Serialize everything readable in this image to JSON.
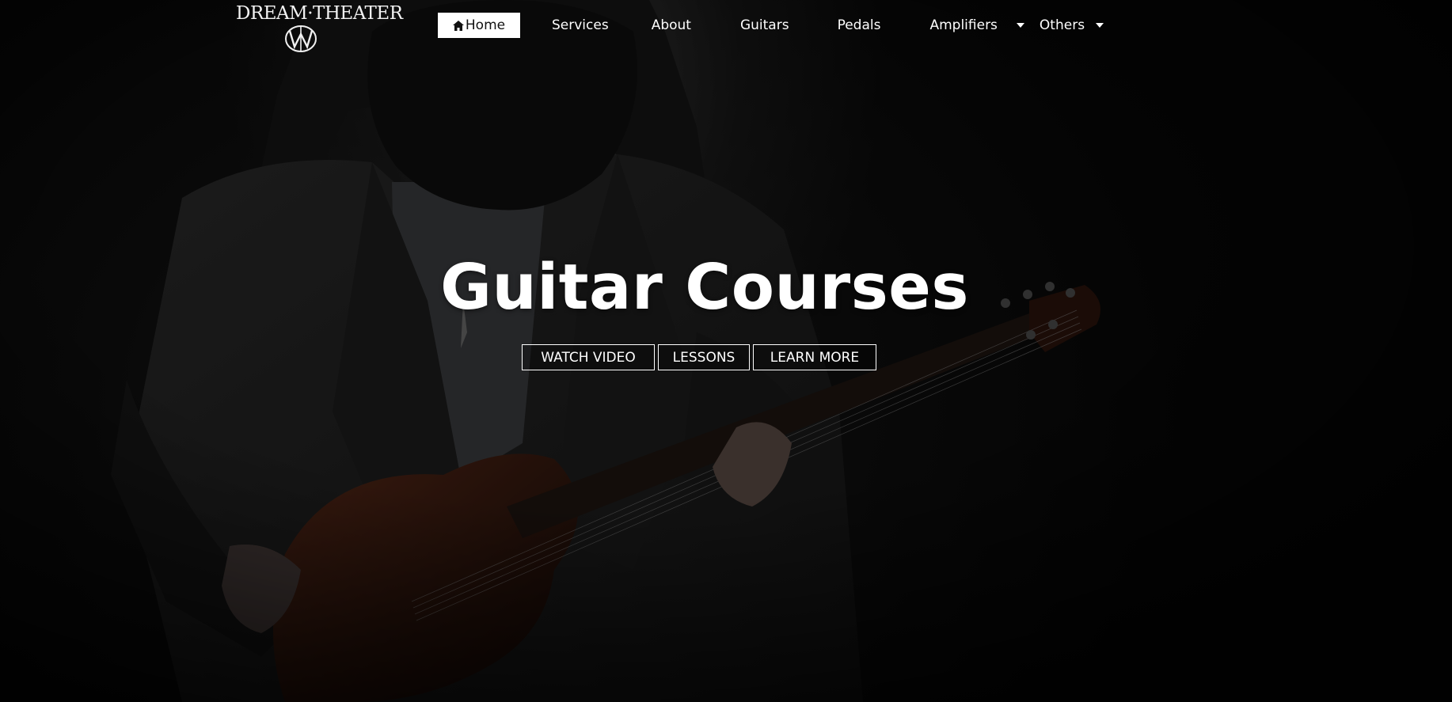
{
  "brand": {
    "logo_text": "DREAM·THEATER",
    "logo_mark_icon": "majesty-symbol-icon"
  },
  "nav": {
    "items": [
      {
        "label": "Home",
        "icon": "home-icon",
        "active": true
      },
      {
        "label": "Services"
      },
      {
        "label": "About"
      },
      {
        "label": "Guitars"
      },
      {
        "label": "Pedals"
      },
      {
        "label": "Amplifiers",
        "dropdown": true
      },
      {
        "label": "Others",
        "dropdown": true
      }
    ]
  },
  "hero": {
    "title": "Guitar Courses",
    "buttons": [
      {
        "label": "WATCH VIDEO"
      },
      {
        "label": "LESSONS"
      },
      {
        "label": "LEARN MORE"
      }
    ]
  },
  "colors": {
    "background": "#060606",
    "text": "#ffffff",
    "active_nav_bg": "#ffffff"
  }
}
